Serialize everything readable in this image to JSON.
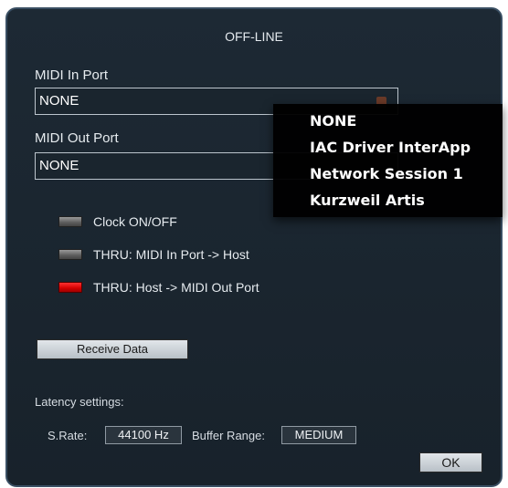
{
  "window": {
    "title": "OFF-LINE"
  },
  "midi_in": {
    "label": "MIDI In Port",
    "value": "NONE"
  },
  "midi_out": {
    "label": "MIDI Out Port",
    "value": "NONE"
  },
  "options": [
    {
      "label": "Clock ON/OFF",
      "on": false
    },
    {
      "label": "THRU: MIDI In Port -> Host",
      "on": false
    },
    {
      "label": "THRU: Host -> MIDI Out Port",
      "on": true
    }
  ],
  "receive_button": {
    "label": "Receive Data"
  },
  "latency": {
    "heading": "Latency settings:",
    "srate_label": "S.Rate:",
    "srate_value": "44100 Hz",
    "buffer_label": "Buffer Range:",
    "buffer_value": "MEDIUM"
  },
  "ok_button": {
    "label": "OK"
  },
  "dropdown": {
    "items": [
      "NONE",
      "IAC Driver InterApp",
      "Network Session 1",
      "Kurzweil Artis"
    ]
  },
  "colors": {
    "led_on": "#d40000",
    "led_off": "#6a6a6a",
    "panel": "#1b2630"
  }
}
